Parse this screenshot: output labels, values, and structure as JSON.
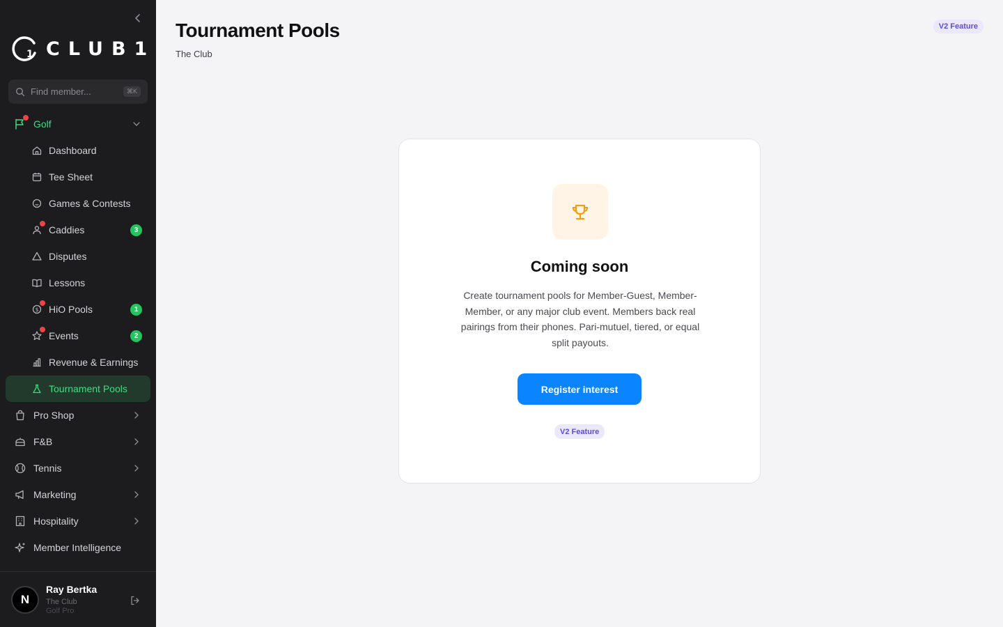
{
  "sidebar": {
    "logo_text": "CLUB1.",
    "search": {
      "placeholder": "Find member...",
      "shortcut": "⌘K"
    },
    "golf": {
      "label": "Golf"
    },
    "golf_items": [
      {
        "label": "Dashboard",
        "icon": "home-icon"
      },
      {
        "label": "Tee Sheet",
        "icon": "calendar-icon"
      },
      {
        "label": "Games & Contests",
        "icon": "smiley-icon"
      },
      {
        "label": "Caddies",
        "icon": "user-icon",
        "badge": "3"
      },
      {
        "label": "Disputes",
        "icon": "warning-icon"
      },
      {
        "label": "Lessons",
        "icon": "book-icon"
      },
      {
        "label": "HiO Pools",
        "icon": "dollar-icon",
        "badge": "1"
      },
      {
        "label": "Events",
        "icon": "star-icon",
        "badge": "2"
      },
      {
        "label": "Revenue & Earnings",
        "icon": "bar-chart-icon"
      },
      {
        "label": "Tournament Pools",
        "icon": "flask-icon"
      }
    ],
    "sections": [
      {
        "label": "Pro Shop",
        "icon": "bag-icon"
      },
      {
        "label": "F&B",
        "icon": "food-icon"
      },
      {
        "label": "Tennis",
        "icon": "tennis-icon"
      },
      {
        "label": "Marketing",
        "icon": "megaphone-icon"
      },
      {
        "label": "Hospitality",
        "icon": "building-icon"
      },
      {
        "label": "Member Intelligence",
        "icon": "sparkle-icon"
      }
    ],
    "user": {
      "initial": "N",
      "name": "Ray Bertka",
      "club": "The Club",
      "role": "Golf Pro"
    }
  },
  "header": {
    "title": "Tournament Pools",
    "subtitle": "The Club",
    "badge": "V2 Feature"
  },
  "card": {
    "title": "Coming soon",
    "description": "Create tournament pools for Member-Guest, Member-Member, or any major club event. Members back real pairings from their phones. Pari-mutuel, tiered, or equal split payouts.",
    "button": "Register interest",
    "badge": "V2 Feature",
    "icon": "trophy-icon"
  },
  "colors": {
    "accent_green": "#3ddc84",
    "primary_blue": "#0a84ff",
    "badge_purple": "#5b4fd1",
    "trophy_orange": "#f59e0b",
    "notification_red": "#ef4444"
  }
}
